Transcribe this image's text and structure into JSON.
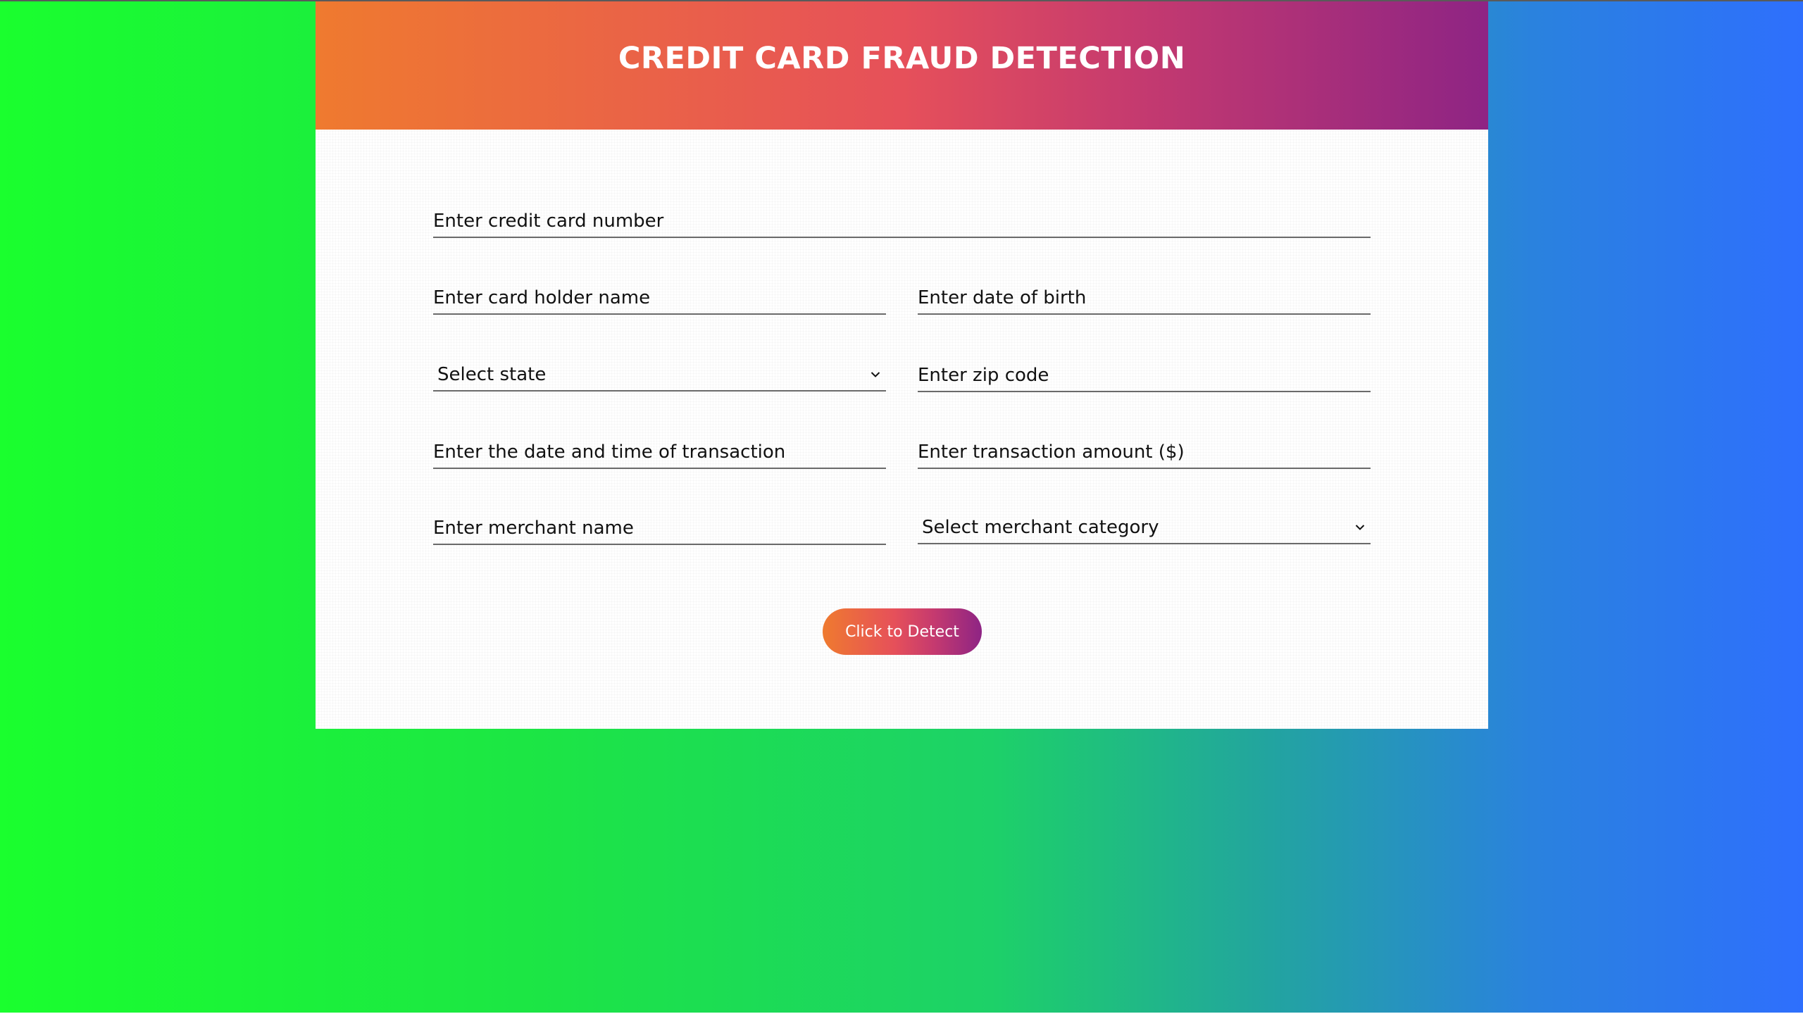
{
  "header": {
    "title": "CREDIT CARD FRAUD DETECTION"
  },
  "form": {
    "card_number": {
      "placeholder": "Enter credit card number",
      "value": ""
    },
    "holder_name": {
      "placeholder": "Enter card holder name",
      "value": ""
    },
    "dob": {
      "placeholder": "Enter date of birth",
      "value": ""
    },
    "state": {
      "selected": "Select state",
      "icon": "chevron-down-icon"
    },
    "zip": {
      "placeholder": "Enter zip code",
      "value": ""
    },
    "datetime": {
      "placeholder": "Enter the date and time of transaction",
      "value": ""
    },
    "amount": {
      "placeholder": "Enter transaction amount ($)",
      "value": ""
    },
    "merchant_name": {
      "placeholder": "Enter merchant name",
      "value": ""
    },
    "merchant_category": {
      "selected": "Select merchant category",
      "icon": "chevron-down-icon"
    },
    "submit_label": "Click to Detect"
  },
  "colors": {
    "background_left": "#1aff2e",
    "background_right": "#2e6ffd",
    "header_start": "#ef7a2f",
    "header_mid": "#e6505a",
    "header_end": "#8e2484",
    "field_underline": "#6a6a6a",
    "text": "#111111"
  }
}
